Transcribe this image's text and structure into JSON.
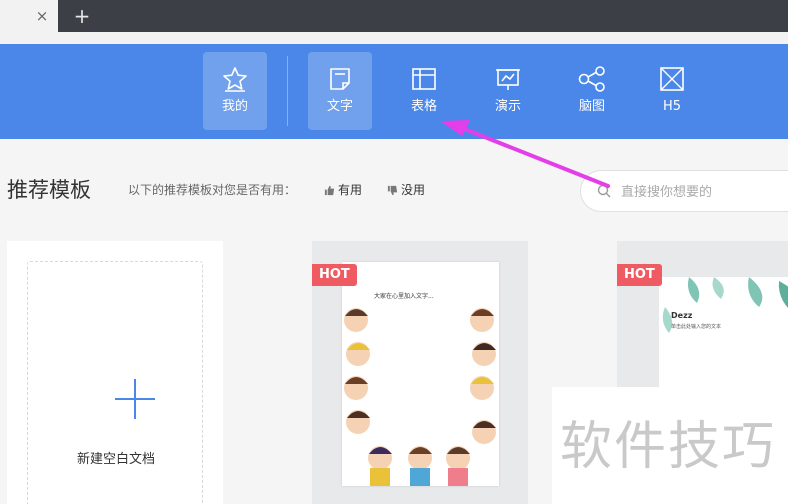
{
  "browser": {
    "close_tab_symbol": "×",
    "new_tab_symbol": "+"
  },
  "typebar": {
    "items": [
      {
        "label": "我的",
        "icon": "star-icon",
        "selected": true
      },
      {
        "label": "文字",
        "icon": "document-icon",
        "selected": true
      },
      {
        "label": "表格",
        "icon": "spreadsheet-icon",
        "selected": false
      },
      {
        "label": "演示",
        "icon": "presentation-icon",
        "selected": false
      },
      {
        "label": "脑图",
        "icon": "mindmap-icon",
        "selected": false
      },
      {
        "label": "H5",
        "icon": "h5-icon",
        "selected": false
      }
    ],
    "accent_color": "#4a87e8"
  },
  "content": {
    "title": "推荐模板",
    "hint": "以下的推荐模板对您是否有用：",
    "useful_label": "有用",
    "useless_label": "没用",
    "search_placeholder": "直接搜你想要的"
  },
  "cards": {
    "blank_label": "新建空白文档",
    "hot_badge": "HOT",
    "template1_caption": "大家在心里加入文字...",
    "template2_brand": "Dezz",
    "template2_caption": "单击此处输入您的文本"
  },
  "watermark": {
    "text": "软件技巧"
  },
  "colors": {
    "hot_badge": "#ef5b62",
    "annotation_arrow": "#e33ee8"
  }
}
